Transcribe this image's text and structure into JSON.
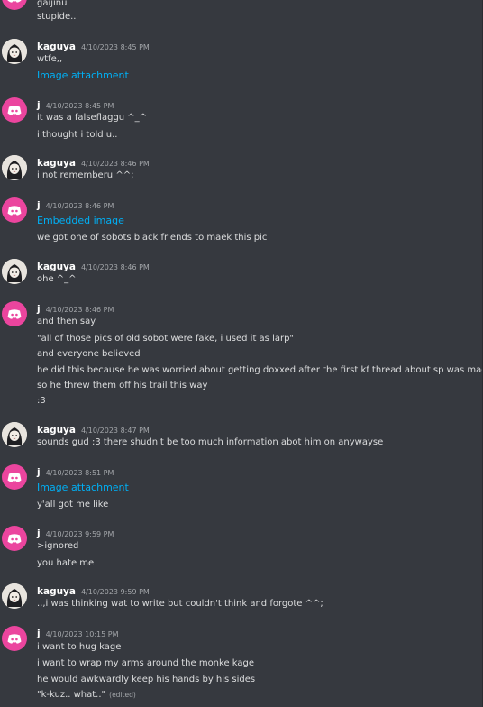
{
  "messages": [
    {
      "type": "continuation",
      "lines": [
        "gaijinu",
        "stupide.."
      ]
    },
    {
      "type": "group",
      "author": "kaguya",
      "avatar": "kaguya-avatar",
      "timestamp": "4/10/2023 8:45 PM",
      "lines": [
        "wtfe,,",
        {
          "link": "Image attachment"
        }
      ]
    },
    {
      "type": "group",
      "author": "j",
      "avatar": "discord-default-avatar",
      "timestamp": "4/10/2023 8:45 PM",
      "lines": [
        "it was a falseflaggu ^_^",
        "i thought i told u.."
      ]
    },
    {
      "type": "group",
      "author": "kaguya",
      "avatar": "kaguya-avatar",
      "timestamp": "4/10/2023 8:46 PM",
      "lines": [
        "i not rememberu ^^;"
      ]
    },
    {
      "type": "group",
      "author": "j",
      "avatar": "discord-default-avatar",
      "timestamp": "4/10/2023 8:46 PM",
      "lines": [
        {
          "link": "Embedded image"
        },
        "we got one of sobots black friends to maek this pic"
      ]
    },
    {
      "type": "group",
      "author": "kaguya",
      "avatar": "kaguya-avatar",
      "timestamp": "4/10/2023 8:46 PM",
      "lines": [
        "ohe ^_^"
      ]
    },
    {
      "type": "group",
      "author": "j",
      "avatar": "discord-default-avatar",
      "timestamp": "4/10/2023 8:46 PM",
      "lines": [
        "and then say",
        "\"all of those pics of old sobot were fake, i used it as larp\"",
        "and everyone believed",
        "he did this because he was worried about getting doxxed after the first kf thread about sp was made",
        "so he threw them off his trail this way",
        ":3"
      ]
    },
    {
      "type": "group",
      "author": "kaguya",
      "avatar": "kaguya-avatar",
      "timestamp": "4/10/2023 8:47 PM",
      "lines": [
        "sounds gud :3 there shudn't be too much information abot him on anywayse"
      ]
    },
    {
      "type": "group",
      "author": "j",
      "avatar": "discord-default-avatar",
      "timestamp": "4/10/2023 8:51 PM",
      "lines": [
        {
          "link": "Image attachment"
        },
        "y'all got me like"
      ]
    },
    {
      "type": "group",
      "author": "j",
      "avatar": "discord-default-avatar",
      "timestamp": "4/10/2023 9:59 PM",
      "lines": [
        ">ignored",
        "you hate me"
      ]
    },
    {
      "type": "group",
      "author": "kaguya",
      "avatar": "kaguya-avatar",
      "timestamp": "4/10/2023 9:59 PM",
      "lines": [
        ".,,i was thinking wat to write but couldn't think and forgote ^^;"
      ]
    },
    {
      "type": "group",
      "author": "j",
      "avatar": "discord-default-avatar",
      "timestamp": "4/10/2023 10:15 PM",
      "lines": [
        "i want to hug kage",
        "i want to wrap my arms around the monke kage",
        "he would awkwardly keep his hands by his sides",
        {
          "text": "\"k-kuz.. what..\"",
          "edited": "(edited)"
        }
      ]
    }
  ],
  "colors": {
    "background": "#36393f",
    "author": "#ffffff",
    "text": "#dcddde",
    "timestamp": "#a3a6aa",
    "link": "#00aff4",
    "discord_avatar": "#eb459e"
  }
}
